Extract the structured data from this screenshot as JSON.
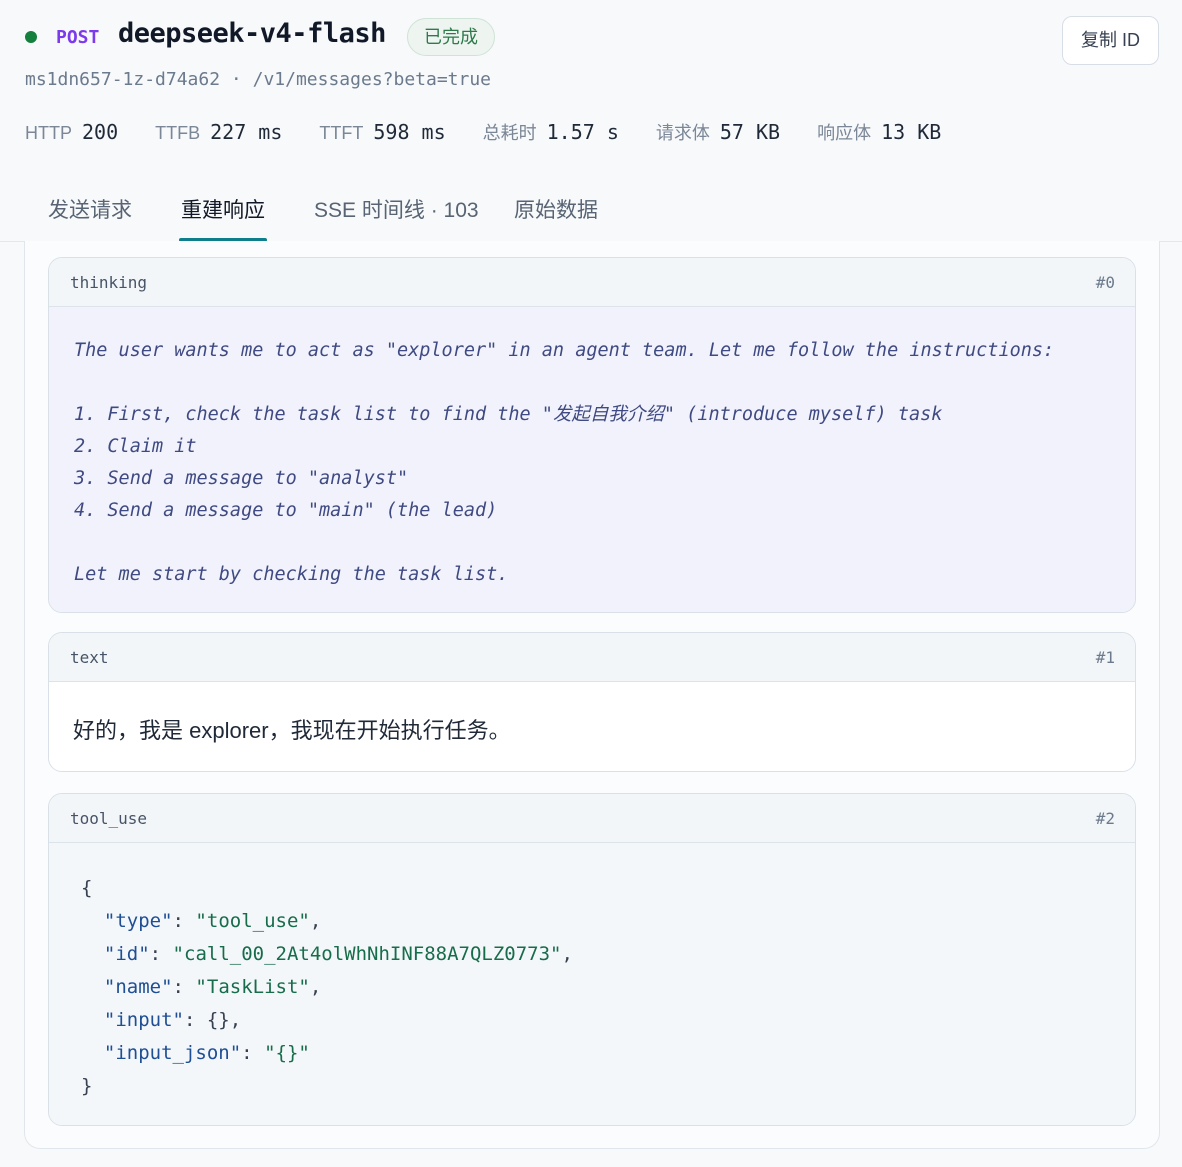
{
  "header": {
    "method": "POST",
    "model": "deepseek-v4-flash",
    "status_badge": "已完成",
    "copy_button": "复制 ID",
    "request_id": "ms1dn657-1z-d74a62",
    "separator": "·",
    "path": "/v1/messages?beta=true"
  },
  "metrics": [
    {
      "label": "HTTP",
      "value": "200"
    },
    {
      "label": "TTFB",
      "value": "227 ms"
    },
    {
      "label": "TTFT",
      "value": "598 ms"
    },
    {
      "label": "总耗时",
      "value": "1.57 s"
    },
    {
      "label": "请求体",
      "value": "57 KB"
    },
    {
      "label": "响应体",
      "value": "13 KB"
    }
  ],
  "tabs": [
    {
      "label": "发送请求"
    },
    {
      "label": "重建响应"
    },
    {
      "label": "SSE 时间线 · 103"
    },
    {
      "label": "原始数据"
    }
  ],
  "active_tab": "重建响应",
  "blocks": {
    "thinking": {
      "type": "thinking",
      "index": "#0",
      "lines": [
        "The user wants me to act as \"explorer\" in an agent team. Let me follow the instructions:",
        "",
        "1. First, check the task list to find the \"发起自我介绍\" (introduce myself) task",
        "2. Claim it",
        "3. Send a message to \"analyst\"",
        "4. Send a message to \"main\" (the lead)",
        "",
        "Let me start by checking the task list."
      ]
    },
    "text": {
      "type": "text",
      "index": "#1",
      "content": "好的，我是 explorer，我现在开始执行任务。"
    },
    "tool_use": {
      "type": "tool_use",
      "index": "#2",
      "json": {
        "type": "tool_use",
        "id": "call_00_2At4olWhNhINF88A7QLZ0773",
        "name": "TaskList",
        "input": "{}",
        "input_json": "{}"
      }
    }
  },
  "colors": {
    "accent": "#0f7e8c",
    "method": "#7c3aed",
    "status_dot": "#15803d",
    "json_key": "#1e4e94",
    "json_string": "#176c4a"
  }
}
